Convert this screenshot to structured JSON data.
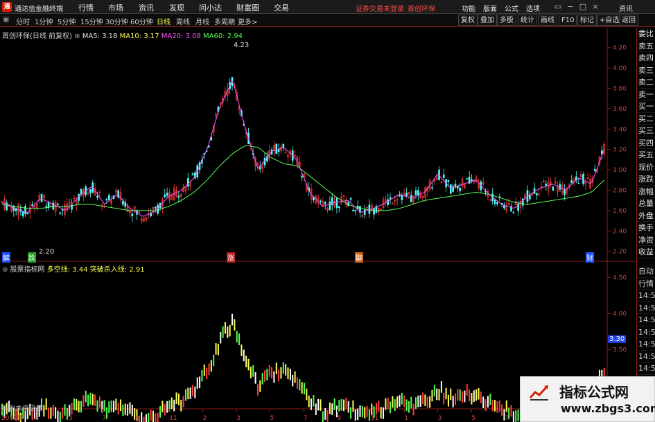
{
  "app": {
    "name": "通达信金融终端",
    "logo_letter": "通"
  },
  "menu": [
    "行情",
    "市场",
    "资讯",
    "发现",
    "问小达",
    "财富圈",
    "交易"
  ],
  "status": {
    "trade_warning": "证券交易未登录",
    "stock_tag": "首创环保"
  },
  "right_menu": [
    "功能",
    "版面",
    "公式",
    "选项",
    "资讯"
  ],
  "periods": [
    "分时",
    "1分钟",
    "5分钟",
    "15分钟",
    "30分钟",
    "60分钟",
    "日线",
    "周线",
    "月线",
    "多周期",
    "更多>"
  ],
  "active_period": "日线",
  "toolbar_buttons": [
    "复权",
    "叠加",
    "多股",
    "统计",
    "画线",
    "F10",
    "标记",
    "+自选",
    "返回"
  ],
  "main_legend": {
    "title": "首创环保(日线 前复权)",
    "ma5": "MA5: 3.18",
    "ma10": "MA10: 3.17",
    "ma20": "MA20: 3.08",
    "ma60": "MA60: 2.94",
    "colors": {
      "ma5": "#e8e8e8",
      "ma10": "#ffff55",
      "ma20": "#ff55ff",
      "ma60": "#55ff55"
    }
  },
  "sub_legend": {
    "title": "股票指标网",
    "line1": "多空线: 3.44",
    "line2": "突破杀入线: 2.91",
    "colors": {
      "line1": "#ffff55",
      "line2": "#ffff55"
    }
  },
  "price_high_label": "4.23",
  "price_low_label": "2.20",
  "main_axis": [
    "4.20",
    "4.00",
    "3.80",
    "3.60",
    "3.40",
    "3.20",
    "3.00",
    "2.80",
    "2.60",
    "2.40",
    "2.20"
  ],
  "sub_axis": [
    "4.50",
    "4.00",
    "3.50",
    "3.00"
  ],
  "sub_current": "3.30",
  "event_markers": [
    "解",
    "跌",
    "涨",
    "聊",
    "财"
  ],
  "bottom_note": "用到未来函数",
  "x_labels": [
    "2019年",
    "3",
    "5",
    "7",
    "9",
    "11",
    "2",
    "3",
    "5",
    "7",
    "9",
    "11",
    "1",
    "3",
    "5",
    "7",
    "9",
    "11"
  ],
  "side_tabs_top": [
    "委比",
    "卖五",
    "卖四",
    "卖三",
    "卖二",
    "卖一",
    "买一",
    "买二",
    "买三",
    "买四",
    "买五",
    "现价",
    "涨跌",
    "涨幅",
    "总量",
    "外盘",
    "换手",
    "净资",
    "收益"
  ],
  "side_tabs_bottom": [
    "自动",
    "行情",
    "14:50",
    "14:50",
    "14:50",
    "14:50",
    "14:50",
    "14:50",
    "14:50",
    "14:50",
    "14:50",
    "14:50"
  ],
  "watermark": {
    "title": "指标公式网",
    "url": "www.zbgs3.com"
  },
  "chart_data": {
    "type": "line",
    "series": [
      {
        "name": "MA5",
        "values": [
          2.68,
          2.62,
          2.58,
          2.72,
          2.66,
          2.6,
          2.74,
          2.84,
          2.66,
          2.76,
          2.62,
          2.54,
          2.6,
          2.74,
          2.8,
          2.92,
          3.2,
          3.62,
          3.88,
          3.4,
          3.0,
          3.18,
          3.22,
          3.1,
          2.78,
          2.64,
          2.68,
          2.7,
          2.58,
          2.62,
          2.68,
          2.76,
          2.72,
          2.78,
          2.96,
          2.82,
          2.86,
          2.9,
          2.76,
          2.66,
          2.62,
          2.74,
          2.82,
          2.86,
          2.8,
          2.92,
          2.86,
          3.2
        ]
      },
      {
        "name": "MA60",
        "values": [
          2.66,
          2.64,
          2.62,
          2.62,
          2.64,
          2.64,
          2.66,
          2.66,
          2.64,
          2.62,
          2.6,
          2.6,
          2.6,
          2.64,
          2.7,
          2.78,
          2.9,
          3.04,
          3.16,
          3.24,
          3.22,
          3.12,
          3.06,
          3.04,
          2.94,
          2.84,
          2.74,
          2.66,
          2.62,
          2.6,
          2.6,
          2.62,
          2.66,
          2.7,
          2.72,
          2.74,
          2.76,
          2.78,
          2.76,
          2.72,
          2.68,
          2.66,
          2.68,
          2.7,
          2.72,
          2.74,
          2.78,
          2.9
        ]
      }
    ],
    "ylim": [
      2.15,
      4.3
    ],
    "sub_ylim": [
      2.7,
      4.6
    ]
  }
}
